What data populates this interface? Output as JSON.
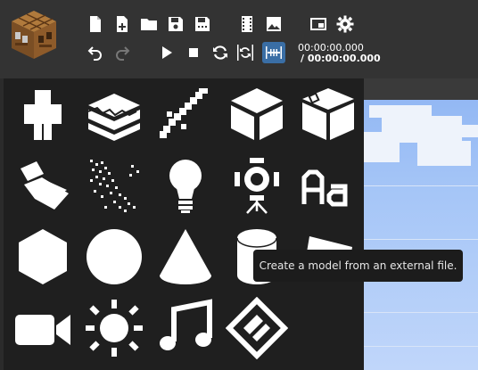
{
  "toolbar": {
    "icons": [
      "new-file-icon",
      "new-file-plus-icon",
      "folder-open-icon",
      "save-icon",
      "save-as-icon",
      "film-icon",
      "image-icon",
      "picture-in-picture-icon",
      "gear-icon",
      "undo-icon",
      "redo-icon",
      "play-icon",
      "stop-icon",
      "loop-icon",
      "sync-icon",
      "timeline-icon"
    ],
    "current_time": "00:00:00.000",
    "total_time": "/ 00:00:00.000"
  },
  "add_panel": {
    "items": [
      "player-model-icon",
      "cake-layers-icon",
      "sword-icon",
      "cube-icon",
      "chest-icon",
      "block-edge-icon",
      "particles-icon",
      "light-bulb-icon",
      "spotlight-icon",
      "text-icon",
      "hexagon-icon",
      "sphere-icon",
      "cone-icon",
      "cylinder-icon",
      "plane-icon",
      "camera-icon",
      "sun-icon",
      "music-note-icon",
      "import-model-icon"
    ]
  },
  "tooltip": {
    "text": "Create a model from an external file."
  },
  "colors": {
    "toolbar": "#333333",
    "panel": "#1f1f1f",
    "active": "#3a6ea5",
    "sky": "#a6c6f7"
  }
}
